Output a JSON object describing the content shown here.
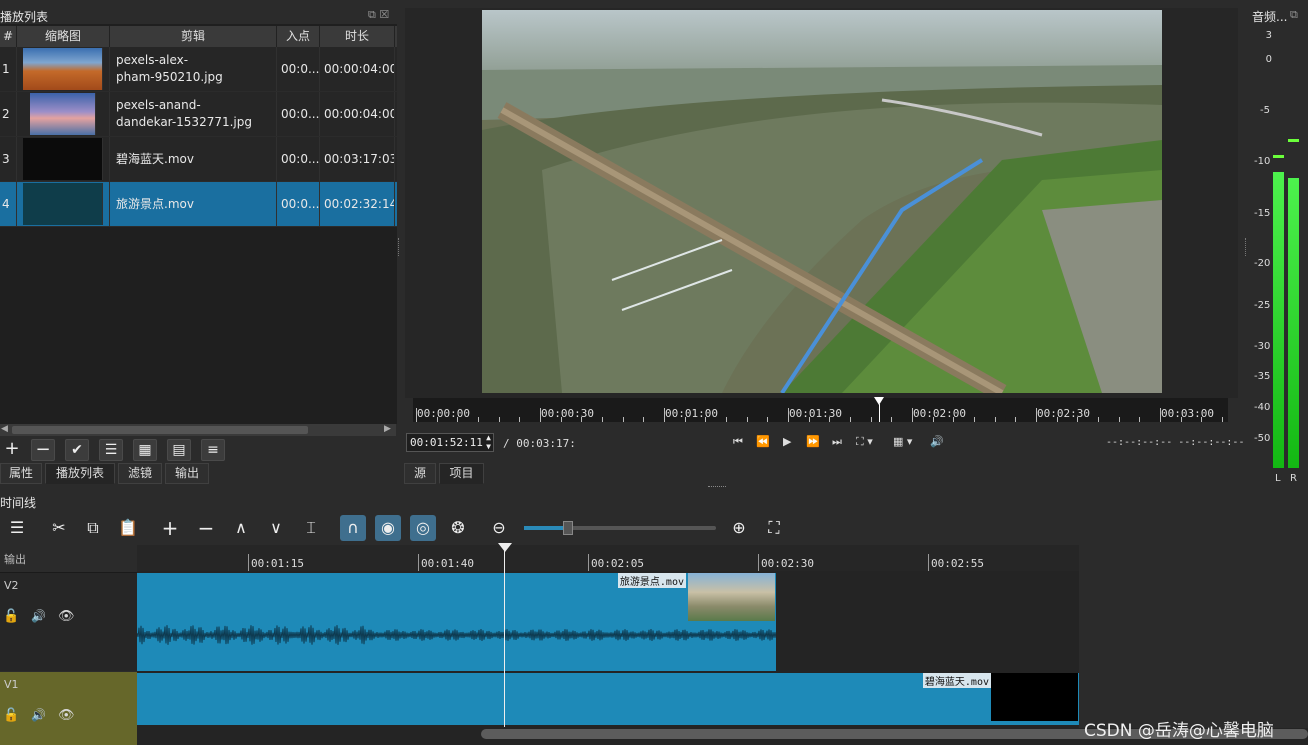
{
  "playlist": {
    "title": "播放列表",
    "columns": [
      "#",
      "缩略图",
      "剪辑",
      "入点",
      "时长"
    ],
    "rows": [
      {
        "num": "1",
        "name_l1": "pexels-alex-",
        "name_l2": "pham-950210.jpg",
        "in": "00:0...",
        "duration": "00:00:04:00"
      },
      {
        "num": "2",
        "name_l1": "pexels-anand-",
        "name_l2": "dandekar-1532771.jpg",
        "in": "00:0...",
        "duration": "00:00:04:00"
      },
      {
        "num": "3",
        "name_l1": "碧海蓝天.mov",
        "name_l2": "",
        "in": "00:0...",
        "duration": "00:03:17:03"
      },
      {
        "num": "4",
        "name_l1": "旅游景点.mov",
        "name_l2": "",
        "in": "00:0...",
        "duration": "00:02:32:14"
      }
    ]
  },
  "left_tabs": [
    "属性",
    "播放列表",
    "滤镜",
    "输出"
  ],
  "viewer": {
    "ruler_labels": [
      "00:00:00",
      "00:00:30",
      "00:01:00",
      "00:01:30",
      "00:02:00",
      "00:02:30",
      "00:03:00"
    ],
    "position": "00:01:52:11",
    "duration": "/ 00:03:17:",
    "timecode_out": "--:--:--:-- --:--:--:--",
    "tabs": [
      "源",
      "项目"
    ]
  },
  "audio_meter": {
    "title": "音频...",
    "scale": [
      "3",
      "0",
      "-5",
      "-10",
      "-15",
      "-20",
      "-25",
      "-30",
      "-35",
      "-40",
      "-50"
    ],
    "channels": [
      "L",
      "R"
    ],
    "level_color": "#22dd22"
  },
  "timeline": {
    "title": "时间线",
    "ruler_labels": [
      "00:01:15",
      "00:01:40",
      "00:02:05",
      "00:02:30",
      "00:02:55"
    ],
    "output_label": "输出",
    "tracks": [
      {
        "name": "V2",
        "clip": "旅游景点.mov"
      },
      {
        "name": "V1",
        "clip": "碧海蓝天.mov"
      }
    ]
  },
  "watermark": "CSDN @岳涛@心馨电脑"
}
